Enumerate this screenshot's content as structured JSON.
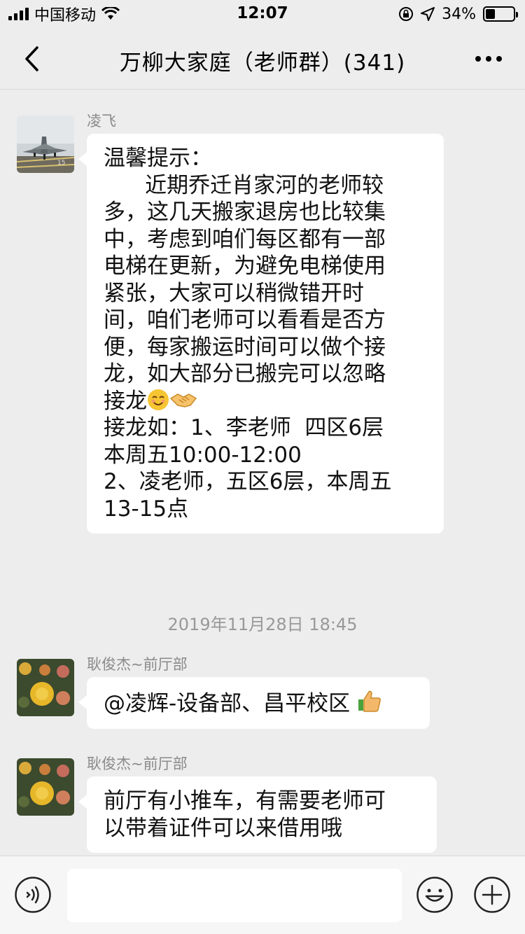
{
  "status_bar": {
    "carrier": "中国移动",
    "time": "12:07",
    "battery": "34%",
    "battery_level": 0.34
  },
  "nav": {
    "title": "万柳大家庭（老师群）(341)",
    "back_icon": "chevron-left-icon",
    "more_icon": "ellipsis-icon"
  },
  "messages": [
    {
      "sender": "凌飞",
      "avatar": "jet-fighter-photo",
      "lines": [
        "温馨提示：",
        "      近期乔迁肖家河的老师较",
        "多，这几天搬家退房也比较集",
        "中，考虑到咱们每区都有一部",
        "电梯在更新，为避免电梯使用",
        "紧张，大家可以稍微错开时",
        "间，咱们老师可以看看是否方",
        "便，每家搬运时间可以做个接",
        "龙，如大部分已搬完可以忽略",
        "接龙",
        "接龙如：1、李老师  四区6层",
        "本周五10:00-12:00",
        "2、凌老师，五区6层，本周五",
        "13-15点"
      ],
      "emojis": [
        "smiling-face-icon",
        "handshake-icon"
      ]
    },
    {
      "sender": "耿俊杰~前厅部",
      "avatar": "yellow-roses-photo",
      "text": "@凌辉-设备部、昌平校区",
      "emoji": "thumbs-up-icon"
    },
    {
      "sender": "耿俊杰~前厅部",
      "avatar": "yellow-roses-photo",
      "lines": [
        "前厅有小推车，有需要老师可",
        "以带着证件可以来借用哦"
      ]
    }
  ],
  "timestamp": "2019年11月28日 18:45",
  "input_bar": {
    "voice_icon": "voice-icon",
    "emoji_icon": "emoji-face-icon",
    "plus_icon": "plus-icon",
    "input_value": ""
  }
}
